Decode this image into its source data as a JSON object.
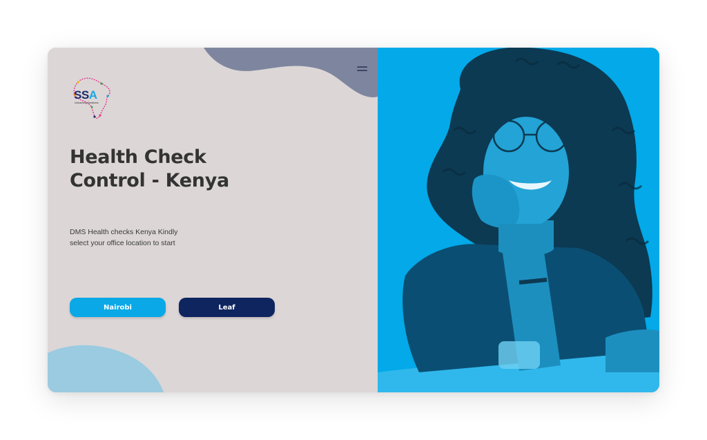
{
  "logo": {
    "text_prefix": "SS",
    "text_accent": "A",
    "tagline": "Unleashing Greatness"
  },
  "hero": {
    "title_line1": "Health Check",
    "title_line2": "Control - Kenya",
    "description_line1": "DMS Health checks Kenya Kindly",
    "description_line2": "select your office location to start"
  },
  "buttons": {
    "nairobi_label": "Nairobi",
    "leaf_label": "Leaf"
  },
  "colors": {
    "panel_bg": "#dcd6d6",
    "photo_bg": "#03a9e8",
    "primary_button": "#0aa8e6",
    "secondary_button": "#0f2560",
    "title_text": "#333333",
    "top_blob": "#7e869f",
    "bottom_blob": "#9acbe0"
  },
  "icons": {
    "menu": "hamburger-menu-icon",
    "logo": "africa-map-icon"
  },
  "photo": {
    "subject": "smiling woman with glasses, chin resting on hand",
    "tint": "cyan duotone"
  }
}
